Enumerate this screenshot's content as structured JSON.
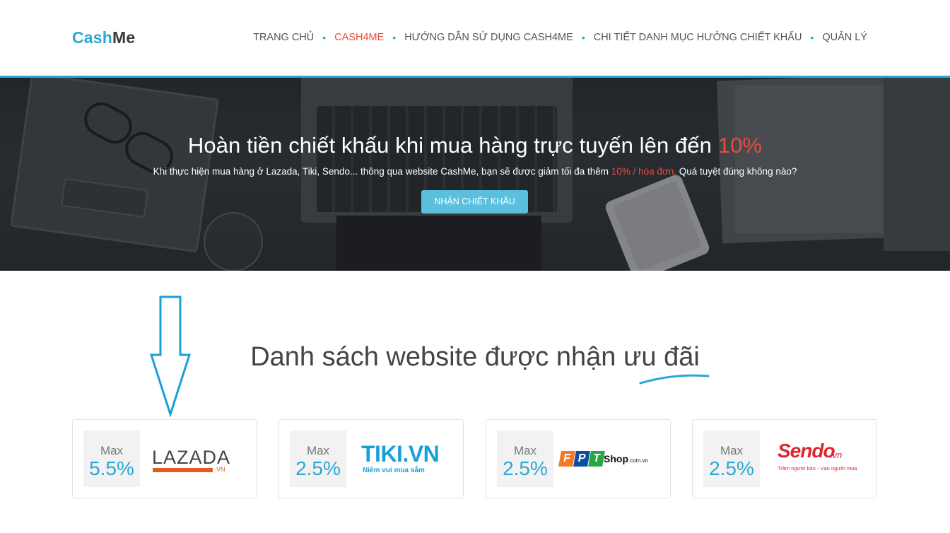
{
  "header": {
    "logo_part1": "Cash",
    "logo_part2": "Me",
    "nav": [
      {
        "label": "TRANG CHỦ",
        "active": false
      },
      {
        "label": "CASH4ME",
        "active": true
      },
      {
        "label": "HƯỚNG DẪN SỬ DỤNG CASH4ME",
        "active": false
      },
      {
        "label": "CHI TIẾT DANH MỤC HƯỞNG CHIẾT KHẤU",
        "active": false
      },
      {
        "label": "QUẢN LÝ",
        "active": false
      }
    ],
    "separator": "•"
  },
  "hero": {
    "title_main": "Hoàn tiền chiết khấu khi mua hàng trực tuyến lên đến ",
    "title_highlight": "10%",
    "subtitle_before": "Khi thực hiện mua hàng ở Lazada, Tiki, Sendo... thông qua website CashMe, bạn sẽ được giảm tối đa thêm ",
    "subtitle_highlight": "10% / hóa đơn.",
    "subtitle_after": " Quá tuyệt đúng không nào?",
    "button_label": "NHẬN CHIẾT KHẤU"
  },
  "section": {
    "title": "Danh sách website được nhận ưu đãi"
  },
  "cards": [
    {
      "max_label": "Max",
      "percent": "5.5%",
      "site": "LAZADA",
      "site_suffix": "·VN"
    },
    {
      "max_label": "Max",
      "percent": "2.5%",
      "site": "TIKI.VN",
      "tagline": "Niềm vui mua sắm"
    },
    {
      "max_label": "Max",
      "percent": "2.5%",
      "fpt_letters": [
        "F",
        "P",
        "T"
      ],
      "site": "Shop",
      "site_suffix": ".com.vn"
    },
    {
      "max_label": "Max",
      "percent": "2.5%",
      "site": "Sendo",
      "site_suffix": ".vn",
      "tagline": "Trăm người bán - Vạn người mua"
    }
  ],
  "colors": {
    "accent": "#29a8d8",
    "highlight": "#e74c3c",
    "button": "#5bc0de",
    "lazada": "#e55a1f",
    "tiki": "#1a9fd9",
    "sendo": "#e0252d",
    "fpt_f": "#f47920",
    "fpt_p": "#0e4da4",
    "fpt_t": "#27a844"
  }
}
